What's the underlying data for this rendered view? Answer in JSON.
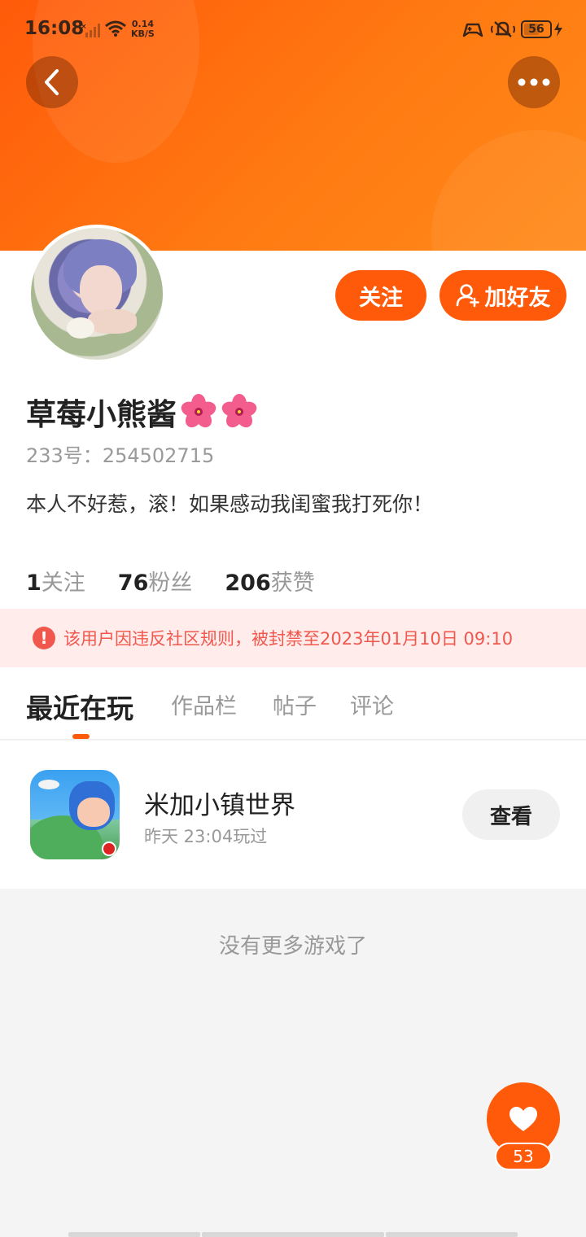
{
  "status_bar": {
    "time": "16:08",
    "speed_value": "0.14",
    "speed_unit": "KB/S",
    "battery": "56"
  },
  "profile": {
    "name": "草莓小熊酱",
    "uid": "233号：254502715",
    "bio": "本人不好惹，滚！如果感动我闺蜜我打死你！",
    "follow_label": "关注",
    "add_friend_label": "加好友",
    "stats": [
      {
        "value": "1",
        "label": "关注"
      },
      {
        "value": "76",
        "label": "粉丝"
      },
      {
        "value": "206",
        "label": "获赞"
      }
    ]
  },
  "ban_notice": "该用户因违反社区规则，被封禁至2023年01月10日 09:10",
  "tabs": [
    "最近在玩",
    "作品栏",
    "帖子",
    "评论"
  ],
  "recent_game": {
    "title": "米加小镇世界",
    "played": "昨天 23:04玩过",
    "button": "查看"
  },
  "no_more": "没有更多游戏了",
  "likes": "53",
  "colors": {
    "accent": "#ff5a0a",
    "ban_text": "#f0584e",
    "ban_bg": "#ffeceb"
  }
}
